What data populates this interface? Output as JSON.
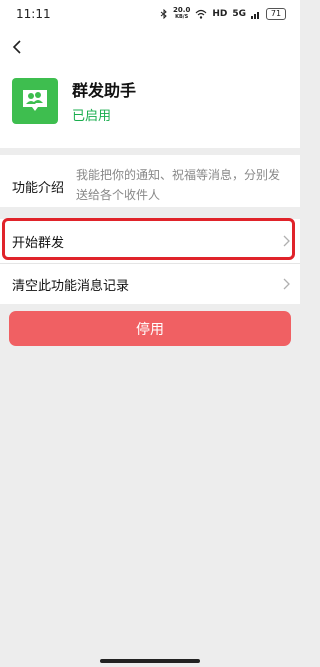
{
  "status_bar": {
    "time": "11:11",
    "net_speed_value": "20.0",
    "net_speed_unit": "KB/S",
    "hd_label": "HD",
    "signal_label": "5G",
    "battery": "71"
  },
  "app": {
    "name": "群发助手",
    "status": "已启用",
    "icon": "group-chat-icon",
    "status_color": "#1aad4e"
  },
  "intro": {
    "label": "功能介绍",
    "text": "我能把你的通知、祝福等消息，分别发送给各个收件人"
  },
  "menu": {
    "start_label": "开始群发",
    "clear_label": "清空此功能消息记录"
  },
  "actions": {
    "disable_label": "停用",
    "disable_color": "#f06063"
  }
}
